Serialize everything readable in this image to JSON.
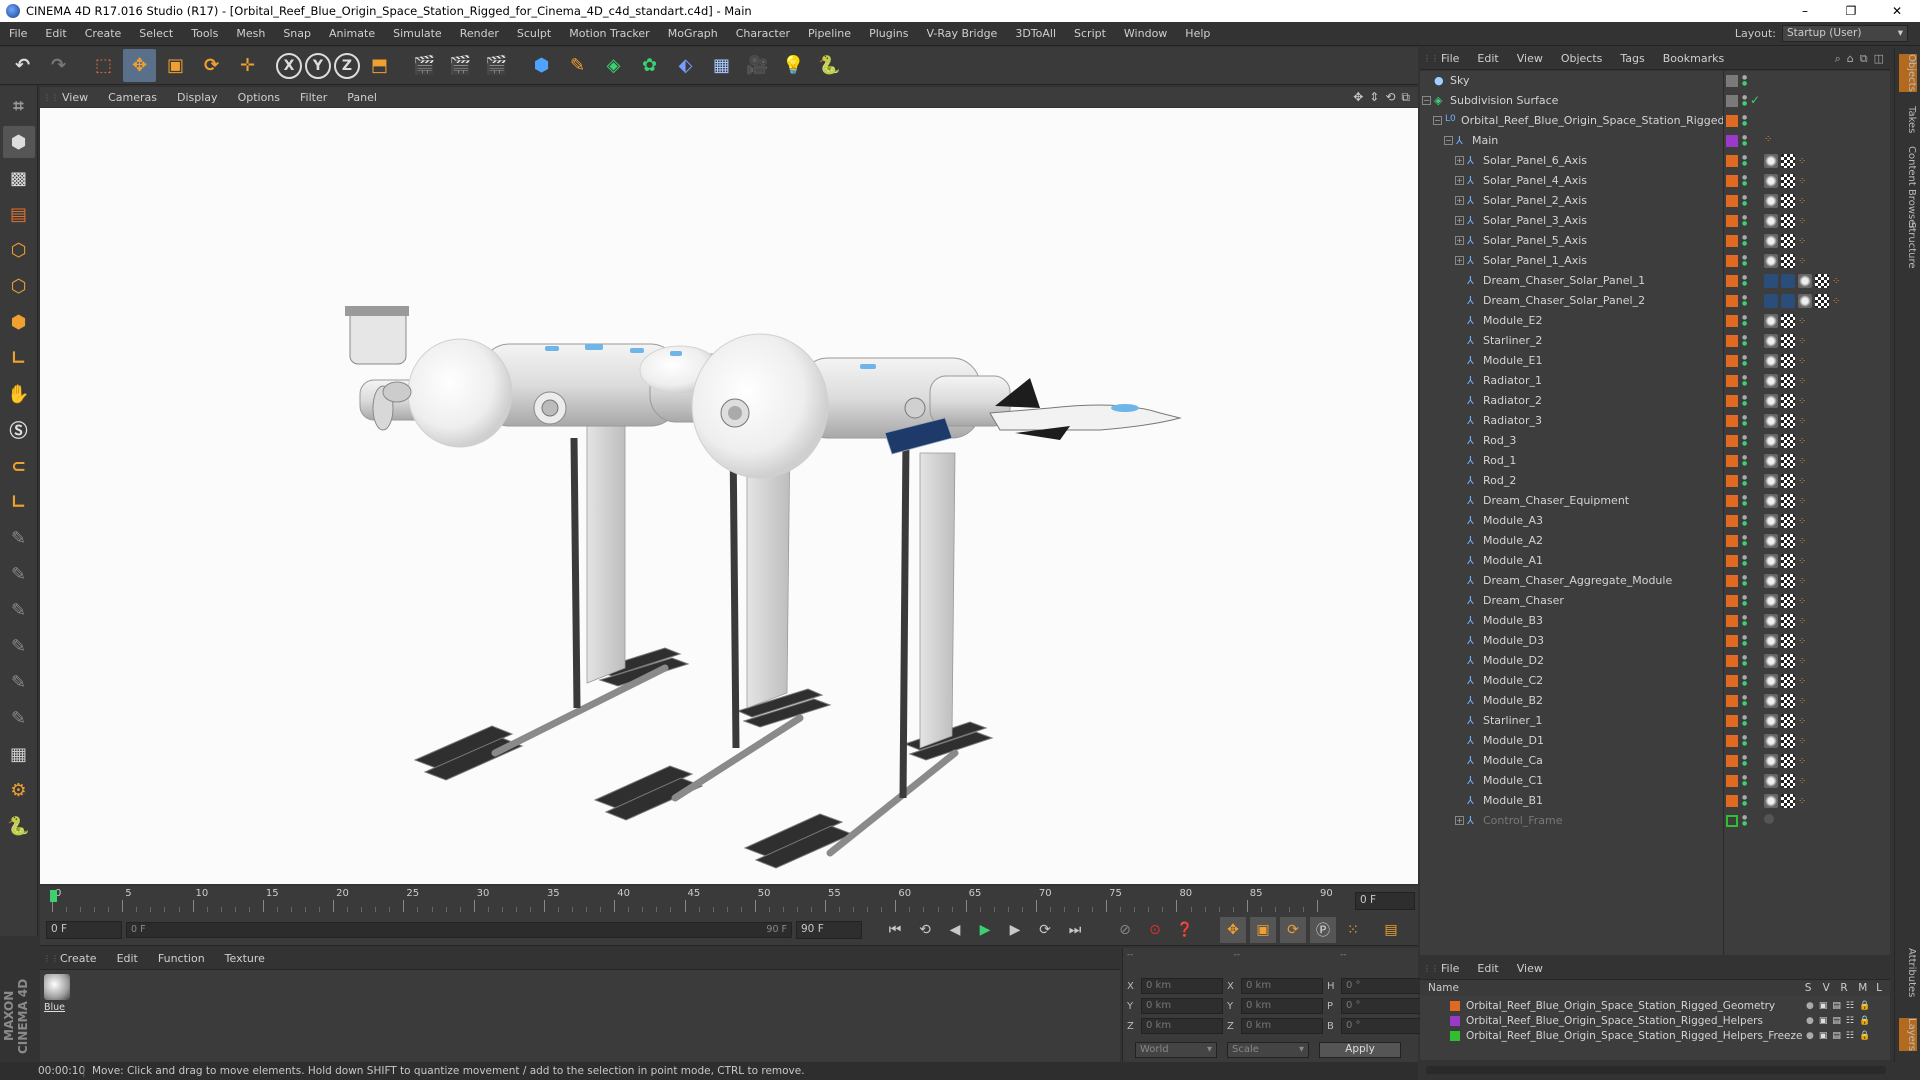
{
  "window": {
    "title": "CINEMA 4D R17.016 Studio (R17) - [Orbital_Reef_Blue_Origin_Space_Station_Rigged_for_Cinema_4D_c4d_standart.c4d] - Main",
    "min": "–",
    "max": "❐",
    "close": "✕"
  },
  "menubar": {
    "items": [
      "File",
      "Edit",
      "Create",
      "Select",
      "Tools",
      "Mesh",
      "Snap",
      "Animate",
      "Simulate",
      "Render",
      "Sculpt",
      "Motion Tracker",
      "MoGraph",
      "Character",
      "Pipeline",
      "Plugins",
      "V-Ray Bridge",
      "3DToAll",
      "Script",
      "Window",
      "Help"
    ],
    "layout_label": "Layout:",
    "layout_value": "Startup (User)"
  },
  "viewport": {
    "menu": [
      "View",
      "Cameras",
      "Display",
      "Options",
      "Filter",
      "Panel"
    ]
  },
  "timeline": {
    "ticks": [
      "0",
      "5",
      "10",
      "15",
      "20",
      "25",
      "30",
      "35",
      "40",
      "45",
      "50",
      "55",
      "60",
      "65",
      "70",
      "75",
      "80",
      "85",
      "90"
    ],
    "current_frame": "0 F",
    "start_field": "0 F",
    "slider_start": "0 F",
    "slider_end": "90 F",
    "end_field": "90 F"
  },
  "material_panel": {
    "menu": [
      "Create",
      "Edit",
      "Function",
      "Texture"
    ],
    "material_name": "Blue"
  },
  "coordinates": {
    "pos_x": "0 km",
    "pos_y": "0 km",
    "pos_z": "0 km",
    "size_x": "0 km",
    "size_y": "0 km",
    "size_z": "0 km",
    "rot_h": "0 °",
    "rot_p": "0 °",
    "rot_b": "0 °",
    "labels": {
      "x": "X",
      "y": "Y",
      "z": "Z",
      "h": "H",
      "p": "P",
      "b": "B"
    },
    "mode_world": "World",
    "mode_scale": "Scale",
    "apply": "Apply",
    "header_left": "--",
    "header_mid": "--",
    "header_right": "--"
  },
  "status": {
    "time": "00:00:10",
    "message": "Move: Click and drag to move elements. Hold down SHIFT to quantize movement / add to the selection in point mode, CTRL to remove."
  },
  "objects_panel": {
    "menu": [
      "File",
      "Edit",
      "View",
      "Objects",
      "Tags",
      "Bookmarks"
    ],
    "items": [
      {
        "name": "Sky",
        "level": 0,
        "color": "#7a7a7a",
        "kind": "sky"
      },
      {
        "name": "Subdivision Surface",
        "level": 0,
        "color": "#7a7a7a",
        "kind": "sds",
        "expanded": true
      },
      {
        "name": "Orbital_Reef_Blue_Origin_Space_Station_Rigged",
        "level": 1,
        "color": "#e06a20",
        "kind": "null",
        "expanded": true
      },
      {
        "name": "Main",
        "level": 2,
        "color": "#9a3ac8",
        "kind": "joint",
        "expanded": true
      },
      {
        "name": "Solar_Panel_6_Axis",
        "level": 3,
        "color": "#e06a20",
        "kind": "joint",
        "expander": true
      },
      {
        "name": "Solar_Panel_4_Axis",
        "level": 3,
        "color": "#e06a20",
        "kind": "joint",
        "expander": true
      },
      {
        "name": "Solar_Panel_2_Axis",
        "level": 3,
        "color": "#e06a20",
        "kind": "joint",
        "expander": true
      },
      {
        "name": "Solar_Panel_3_Axis",
        "level": 3,
        "color": "#e06a20",
        "kind": "joint",
        "expander": true
      },
      {
        "name": "Solar_Panel_5_Axis",
        "level": 3,
        "color": "#e06a20",
        "kind": "joint",
        "expander": true
      },
      {
        "name": "Solar_Panel_1_Axis",
        "level": 3,
        "color": "#e06a20",
        "kind": "joint",
        "expander": true
      },
      {
        "name": "Dream_Chaser_Solar_Panel_1",
        "level": 3,
        "color": "#e06a20",
        "kind": "joint"
      },
      {
        "name": "Dream_Chaser_Solar_Panel_2",
        "level": 3,
        "color": "#e06a20",
        "kind": "joint"
      },
      {
        "name": "Module_E2",
        "level": 3,
        "color": "#e06a20",
        "kind": "joint"
      },
      {
        "name": "Starliner_2",
        "level": 3,
        "color": "#e06a20",
        "kind": "joint"
      },
      {
        "name": "Module_E1",
        "level": 3,
        "color": "#e06a20",
        "kind": "joint"
      },
      {
        "name": "Radiator_1",
        "level": 3,
        "color": "#e06a20",
        "kind": "joint"
      },
      {
        "name": "Radiator_2",
        "level": 3,
        "color": "#e06a20",
        "kind": "joint"
      },
      {
        "name": "Radiator_3",
        "level": 3,
        "color": "#e06a20",
        "kind": "joint"
      },
      {
        "name": "Rod_3",
        "level": 3,
        "color": "#e06a20",
        "kind": "joint"
      },
      {
        "name": "Rod_1",
        "level": 3,
        "color": "#e06a20",
        "kind": "joint"
      },
      {
        "name": "Rod_2",
        "level": 3,
        "color": "#e06a20",
        "kind": "joint"
      },
      {
        "name": "Dream_Chaser_Equipment",
        "level": 3,
        "color": "#e06a20",
        "kind": "joint"
      },
      {
        "name": "Module_A3",
        "level": 3,
        "color": "#e06a20",
        "kind": "joint"
      },
      {
        "name": "Module_A2",
        "level": 3,
        "color": "#e06a20",
        "kind": "joint"
      },
      {
        "name": "Module_A1",
        "level": 3,
        "color": "#e06a20",
        "kind": "joint"
      },
      {
        "name": "Dream_Chaser_Aggregate_Module",
        "level": 3,
        "color": "#e06a20",
        "kind": "joint"
      },
      {
        "name": "Dream_Chaser",
        "level": 3,
        "color": "#e06a20",
        "kind": "joint"
      },
      {
        "name": "Module_B3",
        "level": 3,
        "color": "#e06a20",
        "kind": "joint"
      },
      {
        "name": "Module_D3",
        "level": 3,
        "color": "#e06a20",
        "kind": "joint"
      },
      {
        "name": "Module_D2",
        "level": 3,
        "color": "#e06a20",
        "kind": "joint"
      },
      {
        "name": "Module_C2",
        "level": 3,
        "color": "#e06a20",
        "kind": "joint"
      },
      {
        "name": "Module_B2",
        "level": 3,
        "color": "#e06a20",
        "kind": "joint"
      },
      {
        "name": "Starliner_1",
        "level": 3,
        "color": "#e06a20",
        "kind": "joint"
      },
      {
        "name": "Module_D1",
        "level": 3,
        "color": "#e06a20",
        "kind": "joint"
      },
      {
        "name": "Module_Ca",
        "level": 3,
        "color": "#e06a20",
        "kind": "joint"
      },
      {
        "name": "Module_C1",
        "level": 3,
        "color": "#e06a20",
        "kind": "joint"
      },
      {
        "name": "Module_B1",
        "level": 3,
        "color": "#e06a20",
        "kind": "joint"
      },
      {
        "name": "Control_Frame",
        "level": 3,
        "color": "#2fbf2f",
        "kind": "joint",
        "expander": true,
        "dim": true
      }
    ]
  },
  "layers_panel": {
    "menu": [
      "File",
      "Edit",
      "View"
    ],
    "header": {
      "name": "Name",
      "s": "S",
      "v": "V",
      "r": "R",
      "m": "M",
      "l": "L"
    },
    "items": [
      {
        "name": "Orbital_Reef_Blue_Origin_Space_Station_Rigged_Geometry",
        "color": "#e06a20"
      },
      {
        "name": "Orbital_Reef_Blue_Origin_Space_Station_Rigged_Helpers",
        "color": "#9a3ac8"
      },
      {
        "name": "Orbital_Reef_Blue_Origin_Space_Station_Rigged_Helpers_Freeze",
        "color": "#2fbf2f"
      }
    ]
  },
  "right_tabs": [
    "Objects",
    "Takes",
    "Content Browser",
    "Structure",
    "Attributes",
    "Layers"
  ],
  "branding": "MAXON CINEMA 4D"
}
